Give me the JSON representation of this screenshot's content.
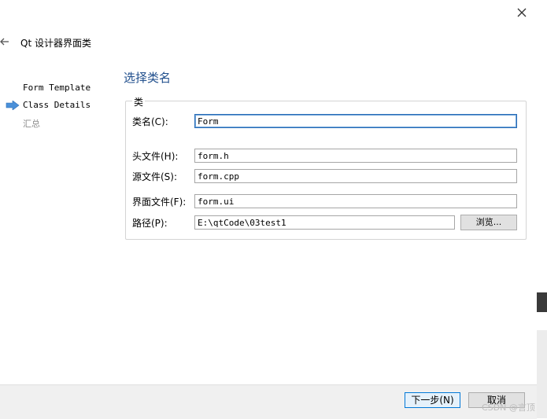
{
  "window": {
    "title": "Qt 设计器界面类"
  },
  "steps": [
    {
      "label": "Form Template"
    },
    {
      "label": "Class Details"
    },
    {
      "label": "汇总"
    }
  ],
  "page": {
    "title": "选择类名"
  },
  "group": {
    "title": "类"
  },
  "form": {
    "class_name": {
      "label": "类名(C):",
      "value": "Form"
    },
    "header": {
      "label": "头文件(H):",
      "value": "form.h"
    },
    "source": {
      "label": "源文件(S):",
      "value": "form.cpp"
    },
    "ui_file": {
      "label": "界面文件(F):",
      "value": "form.ui"
    },
    "path": {
      "label": "路径(P):",
      "value": "E:\\qtCode\\03test1"
    },
    "browse_label": "浏览..."
  },
  "footer": {
    "next_label": "下一步(N)",
    "cancel_label": "取消"
  },
  "watermark": "CSDN @言顶",
  "colors": {
    "accent": "#2a6db8",
    "title": "#1f4e8c",
    "step_arrow": "#4a90d9"
  }
}
